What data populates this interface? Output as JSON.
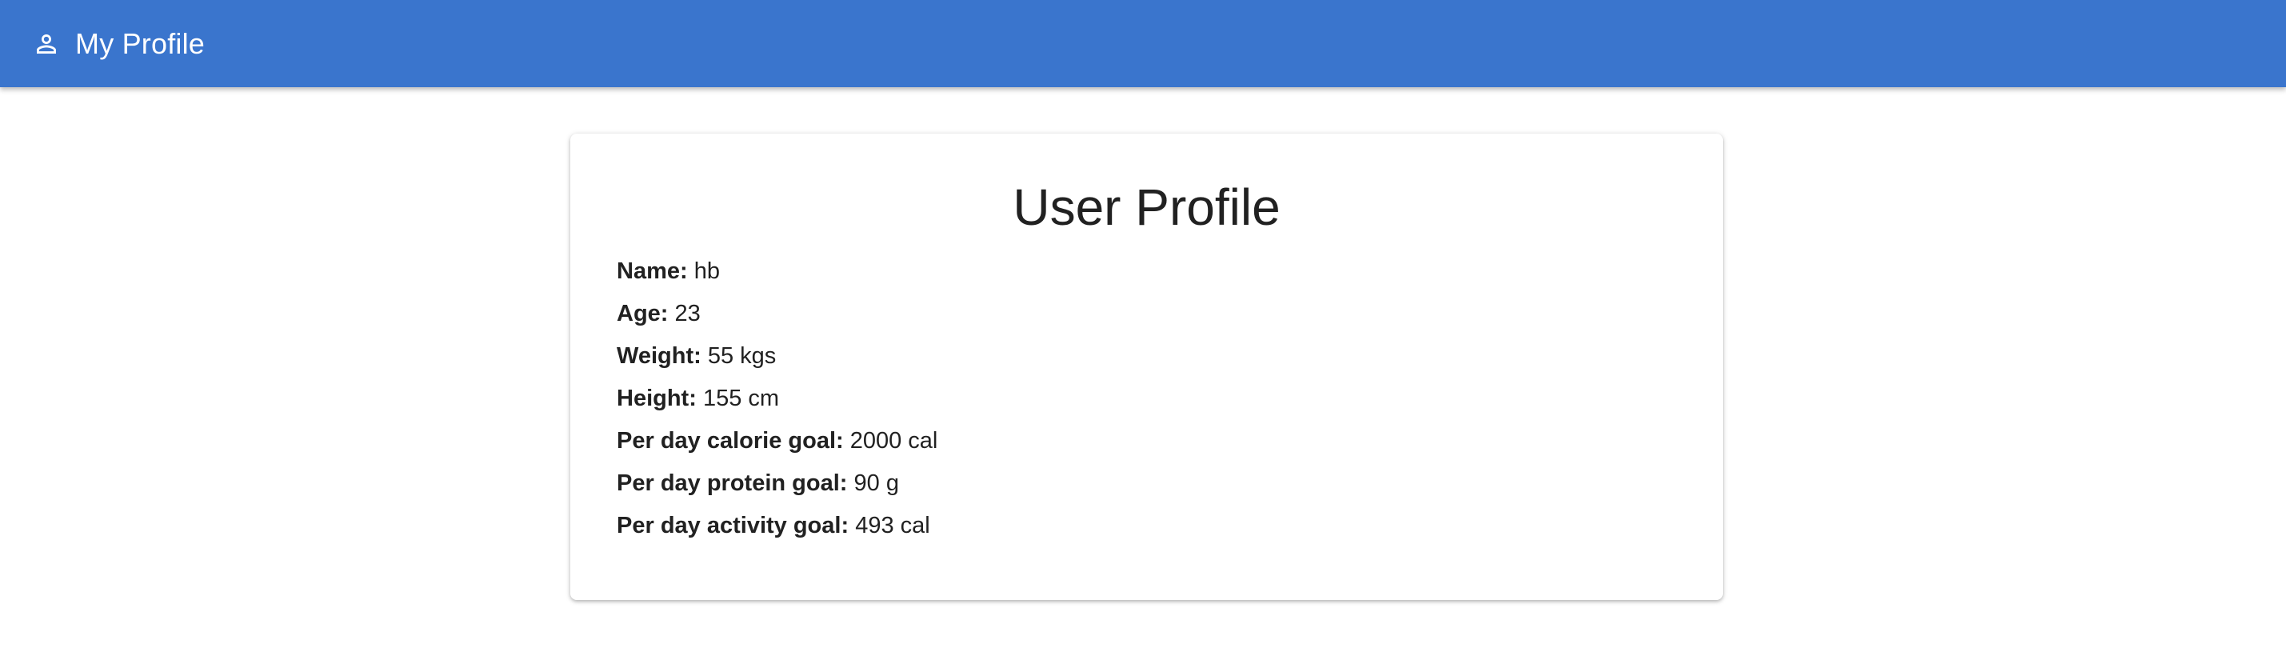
{
  "appbar": {
    "icon": "person-icon",
    "title": "My Profile",
    "color": "#3a75cd"
  },
  "profile": {
    "title": "User Profile",
    "fields": [
      {
        "label": "Name:",
        "value": "hb"
      },
      {
        "label": "Age:",
        "value": "23"
      },
      {
        "label": "Weight:",
        "value": "55 kgs"
      },
      {
        "label": "Height:",
        "value": "155 cm"
      },
      {
        "label": "Per day calorie goal:",
        "value": "2000 cal"
      },
      {
        "label": "Per day protein goal:",
        "value": "90 g"
      },
      {
        "label": "Per day activity goal:",
        "value": "493 cal"
      }
    ]
  }
}
